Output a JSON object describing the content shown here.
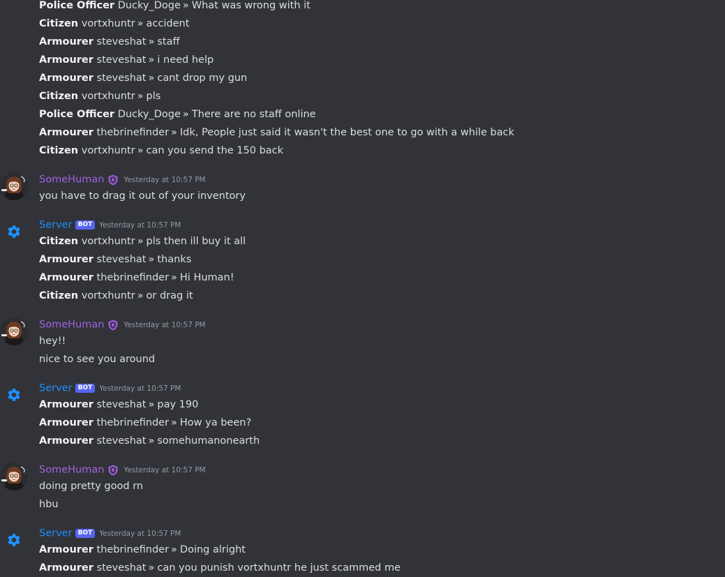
{
  "server_label": "Server",
  "bot_tag": "BOT",
  "human_label": "SomeHuman",
  "separator": "»",
  "colors": {
    "background": "#313338",
    "human_name": "#a363e4",
    "server_name": "#1e90ff",
    "bot_tag": "#5865f2",
    "timestamp": "#949ba4",
    "text": "#dbdee1"
  },
  "messages": [
    {
      "author": "",
      "timestamp": "",
      "lines": [
        {
          "role": "Police Officer",
          "player": "Ducky_Doge",
          "text": "What was wrong with it"
        },
        {
          "role": "Citizen",
          "player": "vortxhuntr",
          "text": "accident"
        },
        {
          "role": "Armourer",
          "player": "steveshat",
          "text": "staff"
        },
        {
          "role": "Armourer",
          "player": "steveshat",
          "text": "i need help"
        },
        {
          "role": "Armourer",
          "player": "steveshat",
          "text": "cant drop my gun"
        },
        {
          "role": "Citizen",
          "player": "vortxhuntr",
          "text": "pls"
        },
        {
          "role": "Police Officer",
          "player": "Ducky_Doge",
          "text": "There are no staff online"
        },
        {
          "role": "Armourer",
          "player": "thebrinefinder",
          "text": "Idk, People just said it wasn't the best one to go with a while back"
        },
        {
          "role": "Citizen",
          "player": "vortxhuntr",
          "text": "can you send the 150 back"
        }
      ]
    },
    {
      "author": "SomeHuman",
      "timestamp": "Yesterday at 10:57 PM",
      "lines": [
        {
          "text": "you have to drag it out of your inventory"
        }
      ]
    },
    {
      "author": "Server",
      "timestamp": "Yesterday at 10:57 PM",
      "lines": [
        {
          "role": "Citizen",
          "player": "vortxhuntr",
          "text": "pls then ill buy it all"
        },
        {
          "role": "Armourer",
          "player": "steveshat",
          "text": "thanks"
        },
        {
          "role": "Armourer",
          "player": "thebrinefinder",
          "text": "Hi Human!"
        },
        {
          "role": "Citizen",
          "player": "vortxhuntr",
          "text": "or drag it"
        }
      ]
    },
    {
      "author": "SomeHuman",
      "timestamp": "Yesterday at 10:57 PM",
      "lines": [
        {
          "text": "hey!!"
        },
        {
          "text": "nice to see you around"
        }
      ]
    },
    {
      "author": "Server",
      "timestamp": "Yesterday at 10:57 PM",
      "lines": [
        {
          "role": "Armourer",
          "player": "steveshat",
          "text": "pay 190"
        },
        {
          "role": "Armourer",
          "player": "thebrinefinder",
          "text": "How ya been?"
        },
        {
          "role": "Armourer",
          "player": "steveshat",
          "text": "somehumanonearth"
        }
      ]
    },
    {
      "author": "SomeHuman",
      "timestamp": "Yesterday at 10:57 PM",
      "lines": [
        {
          "text": "doing pretty good rn"
        },
        {
          "text": "hbu"
        }
      ]
    },
    {
      "author": "Server",
      "timestamp": "Yesterday at 10:57 PM",
      "lines": [
        {
          "role": "Armourer",
          "player": "thebrinefinder",
          "text": "Doing alright"
        },
        {
          "role": "Armourer",
          "player": "steveshat",
          "text": "can you punish vortxhuntr he just scammed me"
        }
      ]
    }
  ]
}
